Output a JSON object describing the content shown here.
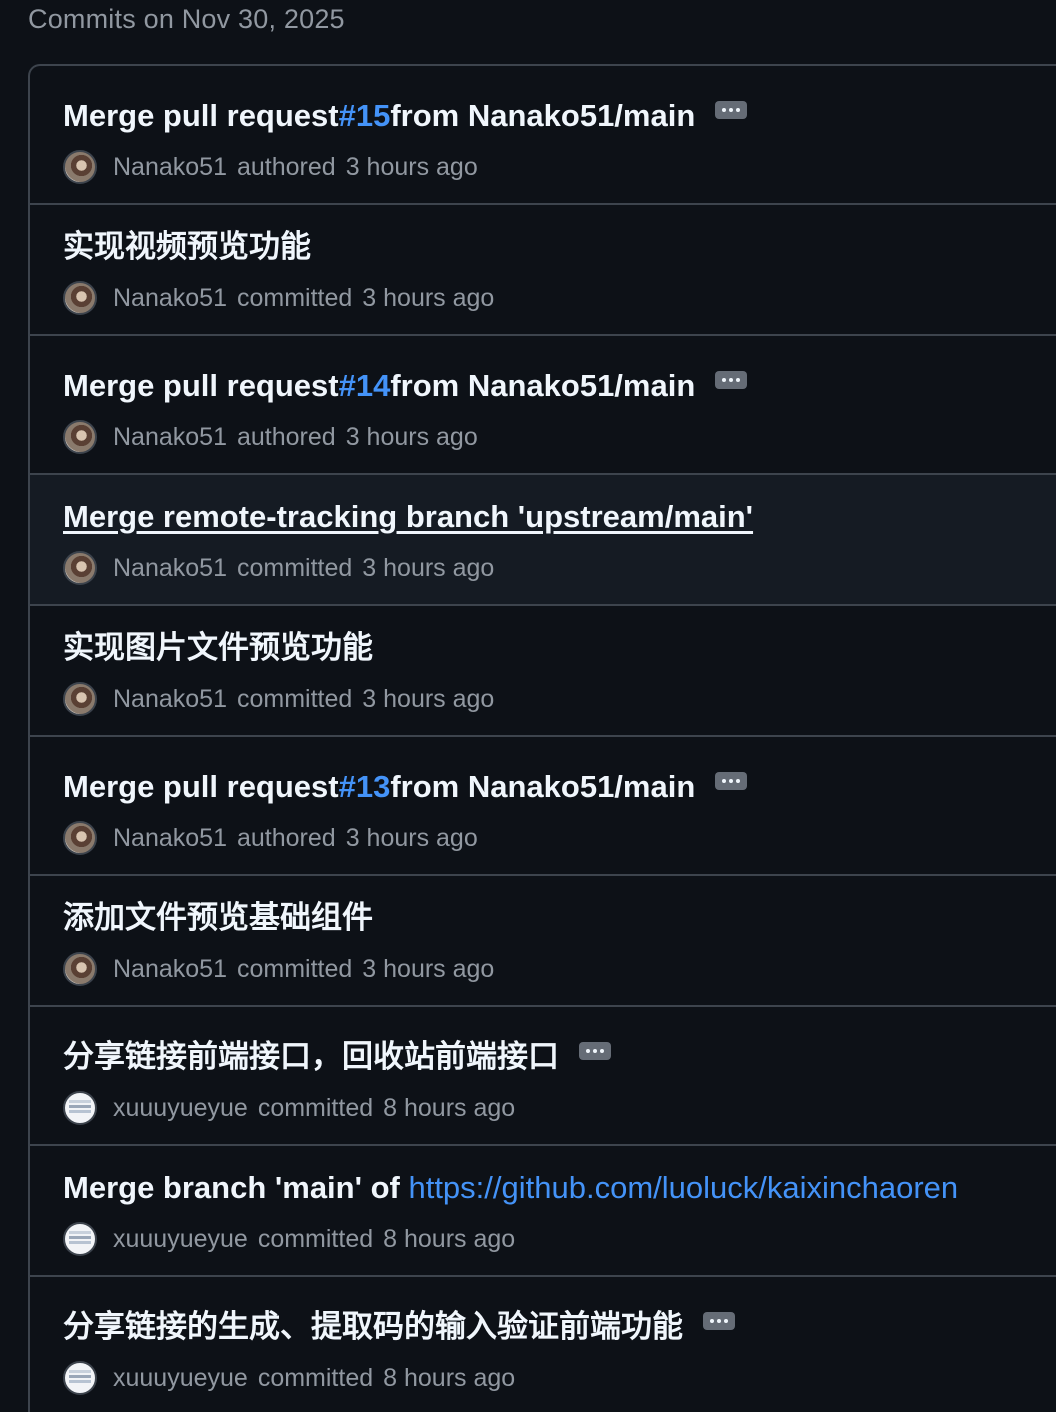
{
  "group_header": "Commits on Nov 30, 2025",
  "commits": [
    {
      "prefix": "Merge pull request ",
      "pr": "#15",
      "suffix": " from Nanako51/main",
      "author": "Nanako51",
      "verb": "authored",
      "time": "3 hours ago",
      "avatar_icon": "nanako-avatar",
      "has_more": true
    },
    {
      "prefix": "实现视频预览功能",
      "pr": "",
      "suffix": "",
      "author": "Nanako51",
      "verb": "committed",
      "time": "3 hours ago",
      "avatar_icon": "nanako-avatar",
      "has_more": false
    },
    {
      "prefix": "Merge pull request ",
      "pr": "#14",
      "suffix": " from Nanako51/main",
      "author": "Nanako51",
      "verb": "authored",
      "time": "3 hours ago",
      "avatar_icon": "nanako-avatar",
      "has_more": true
    },
    {
      "prefix": "Merge remote-tracking branch 'upstream/main'",
      "pr": "",
      "suffix": "",
      "author": "Nanako51",
      "verb": "committed",
      "time": "3 hours ago",
      "avatar_icon": "nanako-avatar",
      "has_more": false
    },
    {
      "prefix": "实现图片文件预览功能",
      "pr": "",
      "suffix": "",
      "author": "Nanako51",
      "verb": "committed",
      "time": "3 hours ago",
      "avatar_icon": "nanako-avatar",
      "has_more": false
    },
    {
      "prefix": "Merge pull request ",
      "pr": "#13",
      "suffix": " from Nanako51/main",
      "author": "Nanako51",
      "verb": "authored",
      "time": "3 hours ago",
      "avatar_icon": "nanako-avatar",
      "has_more": true
    },
    {
      "prefix": "添加文件预览基础组件",
      "pr": "",
      "suffix": "",
      "author": "Nanako51",
      "verb": "committed",
      "time": "3 hours ago",
      "avatar_icon": "nanako-avatar",
      "has_more": false
    },
    {
      "prefix": "分享链接前端接口，回收站前端接口",
      "pr": "",
      "suffix": "",
      "author": "xuuuyueyue",
      "verb": "committed",
      "time": "8 hours ago",
      "avatar_icon": "xuuuyueyue-avatar",
      "has_more": true
    },
    {
      "prefix": "Merge branch 'main' of ",
      "url": "https://github.com/luoluck/kaixinchaoren",
      "author": "xuuuyueyue",
      "verb": "committed",
      "time": "8 hours ago",
      "avatar_icon": "xuuuyueyue-avatar",
      "has_more": false
    },
    {
      "prefix": "分享链接的生成、提取码的输入验证前端功能",
      "pr": "",
      "suffix": "",
      "author": "xuuuyueyue",
      "verb": "committed",
      "time": "8 hours ago",
      "avatar_icon": "xuuuyueyue-avatar",
      "has_more": true
    }
  ]
}
